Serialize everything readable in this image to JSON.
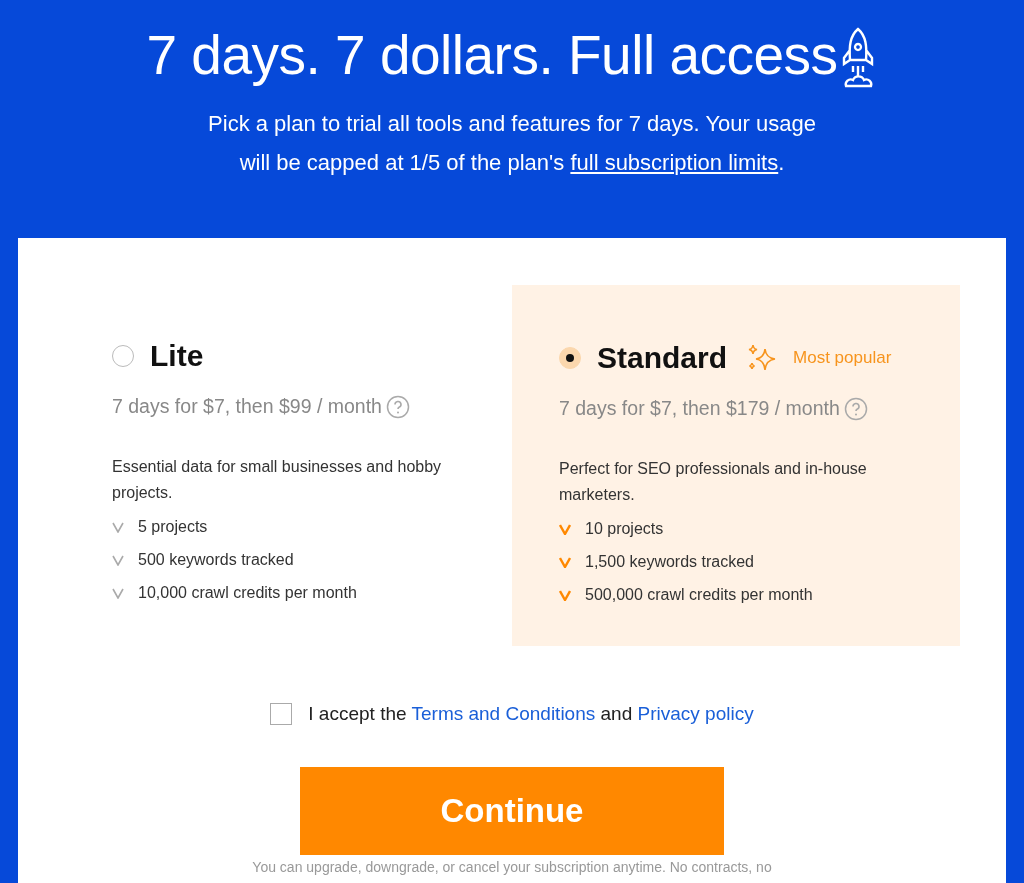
{
  "header": {
    "title": "7 days. 7 dollars. Full access",
    "subtitle_lines": [
      "Pick a plan to trial all tools and features for 7 days. Your usage",
      "will be capped at 1/5 of the plan's "
    ],
    "subtitle_link": "full subscription limits",
    "subtitle_end": "."
  },
  "plans": [
    {
      "name": "Lite",
      "selected": false,
      "price": "7 days for $7, then $99 / month",
      "description": "Essential data for small businesses and hobby projects.",
      "features": [
        "5 projects",
        "500 keywords tracked",
        "10,000 crawl credits per month"
      ]
    },
    {
      "name": "Standard",
      "selected": true,
      "badge": "Most popular",
      "price": "7 days for $7, then $179 / month",
      "description": "Perfect for SEO professionals and in-house marketers.",
      "features": [
        "10 projects",
        "1,500 keywords tracked",
        "500,000 crawl credits per month"
      ]
    }
  ],
  "terms": {
    "checked": false,
    "parts": [
      {
        "kind": "text",
        "text": "I accept the "
      },
      {
        "kind": "link",
        "text": "Terms and Conditions"
      },
      {
        "kind": "text",
        "text": " and "
      },
      {
        "kind": "link",
        "text": "Privacy policy"
      }
    ]
  },
  "button": "Continue",
  "footnote": "You can upgrade, downgrade, or cancel your subscription anytime. No contracts, no"
}
